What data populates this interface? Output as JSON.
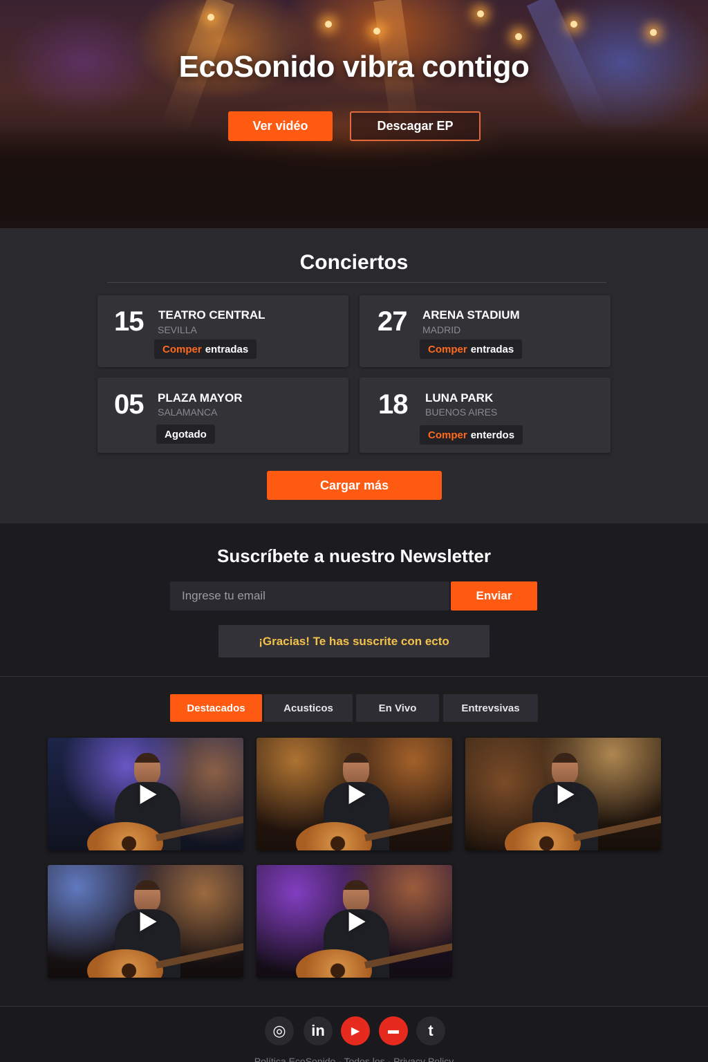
{
  "hero": {
    "title": "EcoSonido vibra contigo",
    "primary_button": "Ver vidéo",
    "secondary_button": "Descagar EP"
  },
  "concerts": {
    "title": "Conciertos",
    "items": [
      {
        "day": "15",
        "venue": "TEATRO CENTRAL",
        "city": "SEVILLA",
        "ticket_highlight": "Comper",
        "ticket_rest": "entradas"
      },
      {
        "day": "27",
        "venue": "ARENA STADIUM",
        "city": "MADRID",
        "ticket_highlight": "Comper",
        "ticket_rest": "entradas"
      },
      {
        "day": "05",
        "venue": "PLAZA MAYOR",
        "city": "SALAMANCA",
        "ticket_highlight": "",
        "ticket_rest": "Agotado"
      },
      {
        "day": "18",
        "venue": "LUNA PARK",
        "city": "BUENOS AIRES",
        "ticket_highlight": "Comper",
        "ticket_rest": "enterdos"
      }
    ],
    "load_more": "Cargar más"
  },
  "newsletter": {
    "title": "Suscríbete a nuestro Newsletter",
    "email_placeholder": "Ingrese tu email",
    "send_button": "Enviar",
    "success_message": "¡Gracias! Te has suscrite con ecto"
  },
  "tabs": [
    {
      "label": "Destacados",
      "active": true
    },
    {
      "label": "Acusticos",
      "active": false
    },
    {
      "label": "En Vivo",
      "active": false
    },
    {
      "label": "Entrevsivas",
      "active": false
    }
  ],
  "videos": [
    {
      "thumbnail": "acoustic-performance-blue-stage"
    },
    {
      "thumbnail": "acoustic-performance-orange-crowd"
    },
    {
      "thumbnail": "acoustic-performance-warm-lights"
    },
    {
      "thumbnail": "acoustic-performance-singing-mic"
    },
    {
      "thumbnail": "acoustic-performance-purple-stage"
    }
  ],
  "social": [
    {
      "icon": "instagram-icon",
      "glyph": "◎"
    },
    {
      "icon": "linkedin-icon",
      "glyph": "in"
    },
    {
      "icon": "youtube-icon",
      "glyph": "▶"
    },
    {
      "icon": "video-icon",
      "glyph": "▬"
    },
    {
      "icon": "tumblr-icon",
      "glyph": "t"
    }
  ],
  "footer_text": "Política EcoSonido · Todos los · Privacy Policy",
  "colors": {
    "accent": "#ff5a12",
    "highlight": "#ff6a1e",
    "success_text": "#f4c24a",
    "card_bg": "#333237",
    "page_bg": "#1d1c1f"
  }
}
